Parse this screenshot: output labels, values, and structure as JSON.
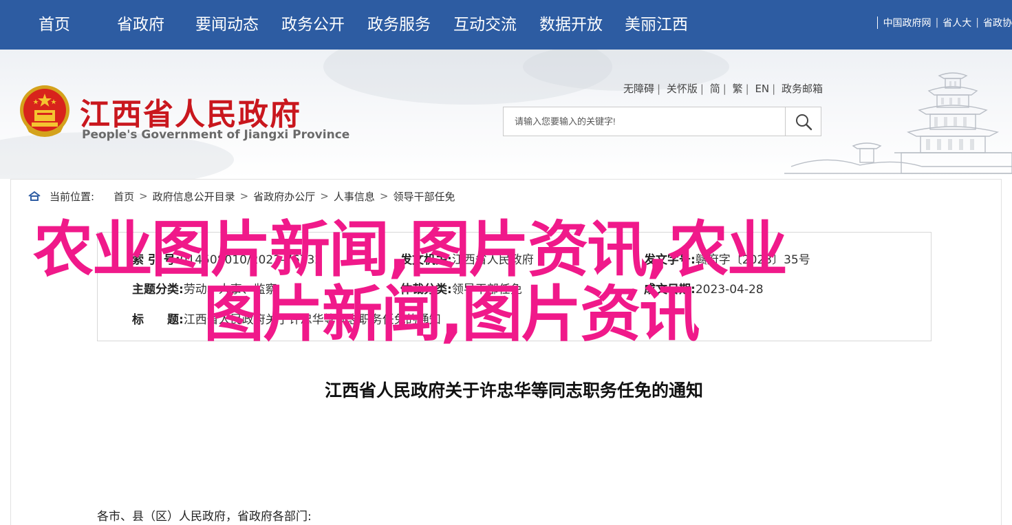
{
  "topnav": {
    "items": [
      "首页",
      "省政府",
      "要闻动态",
      "政务公开",
      "政务服务",
      "互动交流",
      "数据开放",
      "美丽江西"
    ],
    "links": [
      "中国政府网",
      "省人大",
      "省政协"
    ]
  },
  "header": {
    "title": "江西省人民政府",
    "title_en": "People's Government of Jiangxi Province",
    "access_links": [
      "无障碍",
      "关怀版",
      "简",
      "繁",
      "EN",
      "政务邮箱"
    ],
    "search_placeholder": "请输入您要输入的关键字!"
  },
  "breadcrumb": {
    "label": "当前位置:",
    "items": [
      "首页",
      "政府信息公开目录",
      "省政府办公厅",
      "人事信息",
      "领导干部任免"
    ]
  },
  "info": {
    "index_label": "索 引 号:",
    "index_value": "014508010/2023-76732",
    "issuer_label": "发文机关:",
    "issuer_value": "江西省人民政府",
    "docno_label": "发文字号:",
    "docno_value": "赣府字〔2023〕35号",
    "topic_label": "主题分类:",
    "topic_value": "劳动、人事、监察",
    "genre_label": "体裁分类:",
    "genre_value": "领导干部任免",
    "date_label": "成文日期:",
    "date_value": "2023-04-28",
    "title_label": "标　　题:",
    "title_value": "江西省人民政府关于许忠华等同志职务任免的通知"
  },
  "document": {
    "title": "江西省人民政府关于许忠华等同志职务任免的通知",
    "salutation": "各市、县（区）人民政府，省政府各部门:"
  },
  "overlay": {
    "line1": "农业图片新闻,图片资讯,农业",
    "line2": "图片新闻,图片资讯"
  },
  "colors": {
    "nav_bg": "#2d5ca2",
    "title_red": "#c9171e",
    "overlay_pink": "#f0198a"
  },
  "icons": [
    "emblem-icon",
    "search-icon",
    "home-icon",
    "pavilion-illustration"
  ]
}
